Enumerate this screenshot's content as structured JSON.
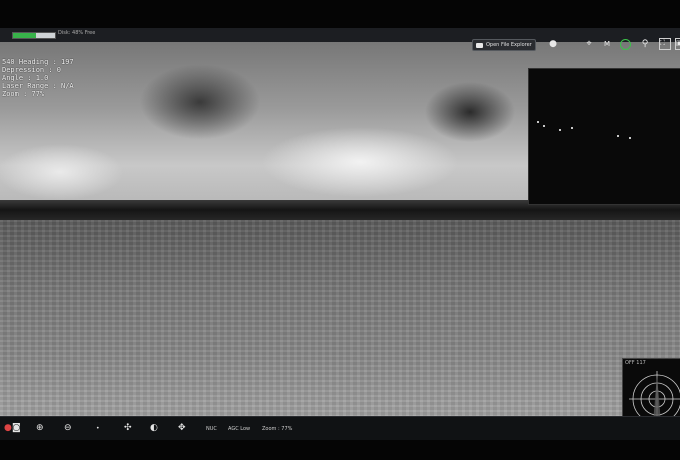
{
  "topbar": {
    "disk_text": "Disk: 48% Free",
    "disk_used_fraction": 0.55,
    "explorer_button_label": "Open File Explorer",
    "mode_letter": "M"
  },
  "hud": {
    "lines": [
      "540 Heading : 197",
      "Depression : 0",
      "Angle : 1.0",
      "Laser Range : N/A",
      "Zoom : 77%"
    ]
  },
  "radar": {
    "label": "OFF 117"
  },
  "bottombar": {
    "labels": {
      "nuc": "NUC",
      "agc": "AGC Low",
      "zoom": "Zoom : 77%"
    },
    "icons": [
      "record-icon",
      "camera-icon",
      "zoom-in-icon",
      "zoom-out-icon",
      "point-icon",
      "settings-icon",
      "contrast-icon",
      "drone-icon"
    ]
  },
  "colors": {
    "accent": "#38b24a",
    "crosshair": "#3cc24a"
  }
}
